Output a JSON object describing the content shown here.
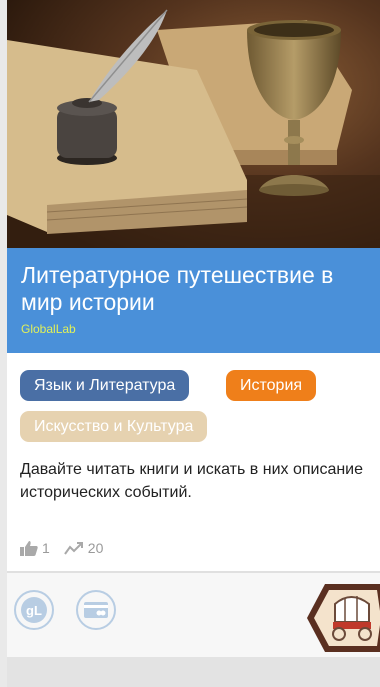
{
  "card": {
    "title": "Литературное путешествие в мир истории",
    "brand": "GlobalLab",
    "tags": [
      {
        "label": "Язык и Литература",
        "color": "#4a6fa5"
      },
      {
        "label": "История",
        "color": "#ef7f1a"
      },
      {
        "label": "Искусство и Культура",
        "color": "#e6d2b0"
      }
    ],
    "description": "Давайте читать книги и искать в них описание исторических событий.",
    "stats": {
      "likes": "1",
      "views": "20"
    },
    "header_color": "#4a90d9"
  },
  "footer": {
    "icons": [
      "globallab-icon",
      "card-icon",
      "covered-wagon-badge-icon"
    ]
  }
}
